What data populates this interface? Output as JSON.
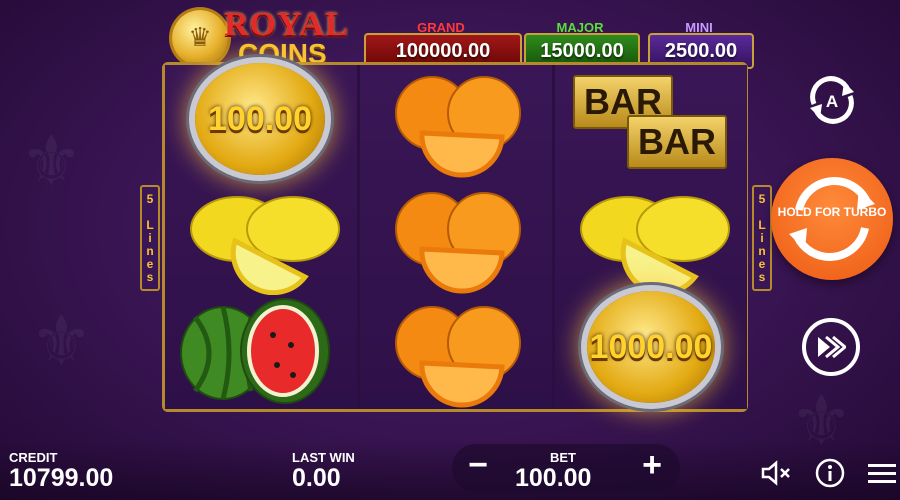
{
  "logo": {
    "line1": "ROYAL",
    "line2": "COINS"
  },
  "jackpots": {
    "grand": {
      "label": "GRAND",
      "value": "100000.00",
      "color": "#a11818"
    },
    "major": {
      "label": "MAJOR",
      "value": "15000.00",
      "color": "#2f8a1c"
    },
    "mini": {
      "label": "MINI",
      "value": "2500.00",
      "color": "#5a2a9a"
    }
  },
  "lines_tab": {
    "count": "5",
    "word": [
      "L",
      "i",
      "n",
      "e",
      "s"
    ]
  },
  "reels": [
    [
      "coin",
      "lemon",
      "watermelon"
    ],
    [
      "orange",
      "orange",
      "orange"
    ],
    [
      "bar",
      "lemon",
      "coin"
    ]
  ],
  "coins": {
    "reel1_top": "100.00",
    "reel3_bottom": "1000.00"
  },
  "bar_text": "BAR",
  "buttons": {
    "autoplay_letter": "A",
    "spin_label": "HOLD FOR TURBO",
    "spin_color": "#ec5a12"
  },
  "footer": {
    "credit_label": "CREDIT",
    "credit_value": "10799.00",
    "lastwin_label": "LAST WIN",
    "lastwin_value": "0.00",
    "bet_label": "BET",
    "bet_value": "100.00",
    "minus": "−",
    "plus": "+"
  },
  "icons": [
    "autoplay-icon",
    "spin-icon",
    "fast-forward-icon",
    "sound-off-icon",
    "info-icon",
    "menu-icon"
  ]
}
